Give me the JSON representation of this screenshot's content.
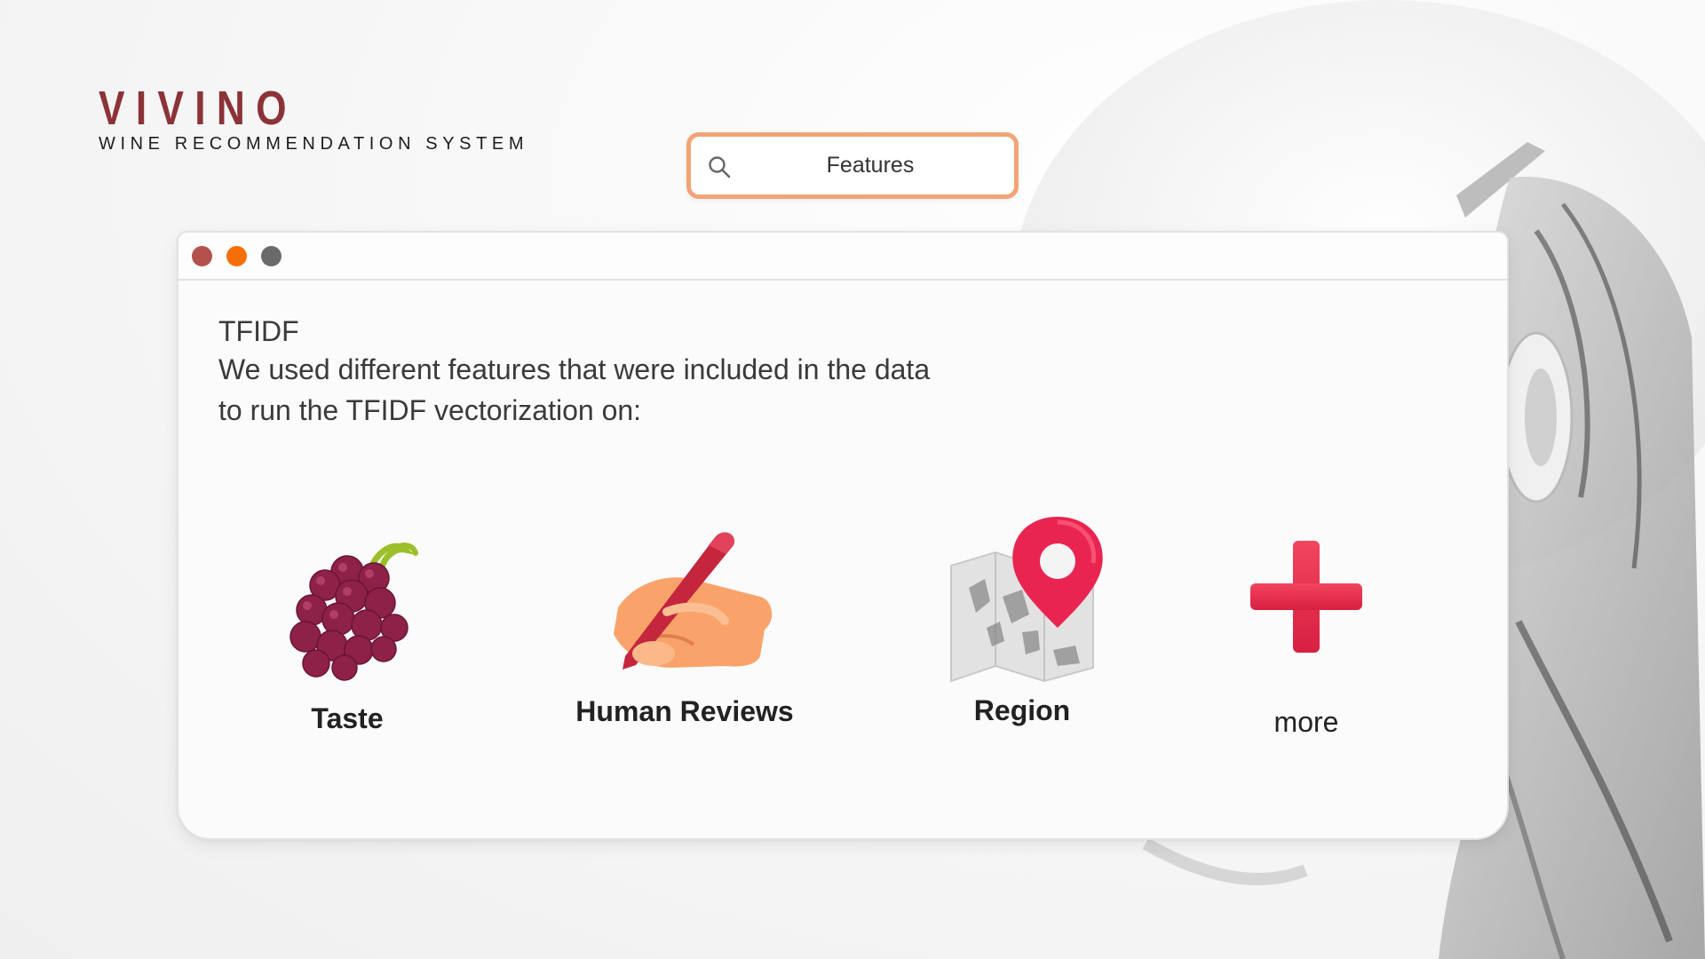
{
  "brand": {
    "name": "VIVINO",
    "subtitle": "WINE RECOMMENDATION SYSTEM"
  },
  "search": {
    "value": "Features"
  },
  "window": {
    "title_bar_buttons": [
      "close",
      "minimize",
      "maximize"
    ],
    "heading": "TFIDF",
    "description": "We used different features that were included in the data to run the TFIDF vectorization on:",
    "features": [
      {
        "label": "Taste",
        "icon": "grapes-icon"
      },
      {
        "label": "Human Reviews",
        "icon": "writing-hand-icon"
      },
      {
        "label": "Region",
        "icon": "map-pin-icon"
      },
      {
        "label": "more",
        "icon": "plus-icon"
      }
    ]
  },
  "colors": {
    "brand": "#8c3338",
    "search_border": "#f2a476",
    "close_dot": "#b4514d",
    "minimize_dot": "#f56f06",
    "maximize_dot": "#6a6a6a",
    "plus": "#e8384f"
  }
}
